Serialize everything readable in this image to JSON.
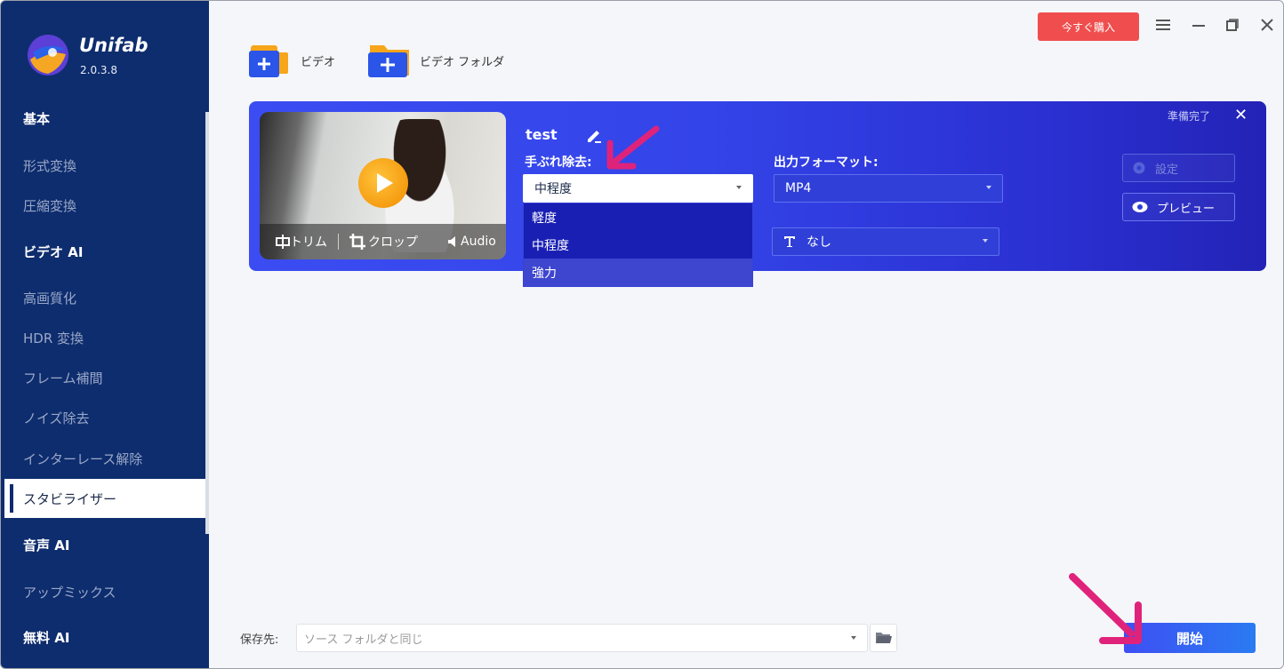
{
  "app": {
    "name": "Unifab",
    "version": "2.0.3.8"
  },
  "titlebar": {
    "buy_label": "今すぐ購入"
  },
  "sidebar": {
    "items": [
      {
        "label": "基本",
        "section": true
      },
      {
        "label": "形式変換"
      },
      {
        "label": "圧縮変換"
      },
      {
        "label": "ビデオ AI",
        "section": true
      },
      {
        "label": "高画質化"
      },
      {
        "label": "HDR 変換"
      },
      {
        "label": "フレーム補間"
      },
      {
        "label": "ノイズ除去"
      },
      {
        "label": "インターレース解除"
      },
      {
        "label": "スタビライザー",
        "active": true
      },
      {
        "label": "音声 AI",
        "section": true
      },
      {
        "label": "アップミックス"
      },
      {
        "label": "無料 AI",
        "section": true
      }
    ]
  },
  "toolbar": {
    "add_video": "ビデオ",
    "add_folder": "ビデオ フォルダ"
  },
  "card": {
    "file_name": "test",
    "status": "準備完了",
    "thumb_bar": {
      "trim": "トリム",
      "crop": "クロップ",
      "audio": "Audio"
    },
    "shake_label": "手ぶれ除去:",
    "shake_value": "中程度",
    "shake_options": [
      "軽度",
      "中程度",
      "強力"
    ],
    "shake_hover_index": 2,
    "format_label": "出力フォーマット:",
    "format_value": "MP4",
    "subtitle_value": "なし",
    "settings_label": "設定",
    "preview_label": "プレビュー"
  },
  "bottom": {
    "save_label": "保存先:",
    "save_placeholder": "ソース フォルダと同じ",
    "start_label": "開始"
  },
  "colors": {
    "sidebar": "#0e2d6e",
    "card": "#3b4df2",
    "buy": "#f04e4e",
    "start": "#3e4ff3",
    "annotation_arrow": "#e0237a"
  }
}
